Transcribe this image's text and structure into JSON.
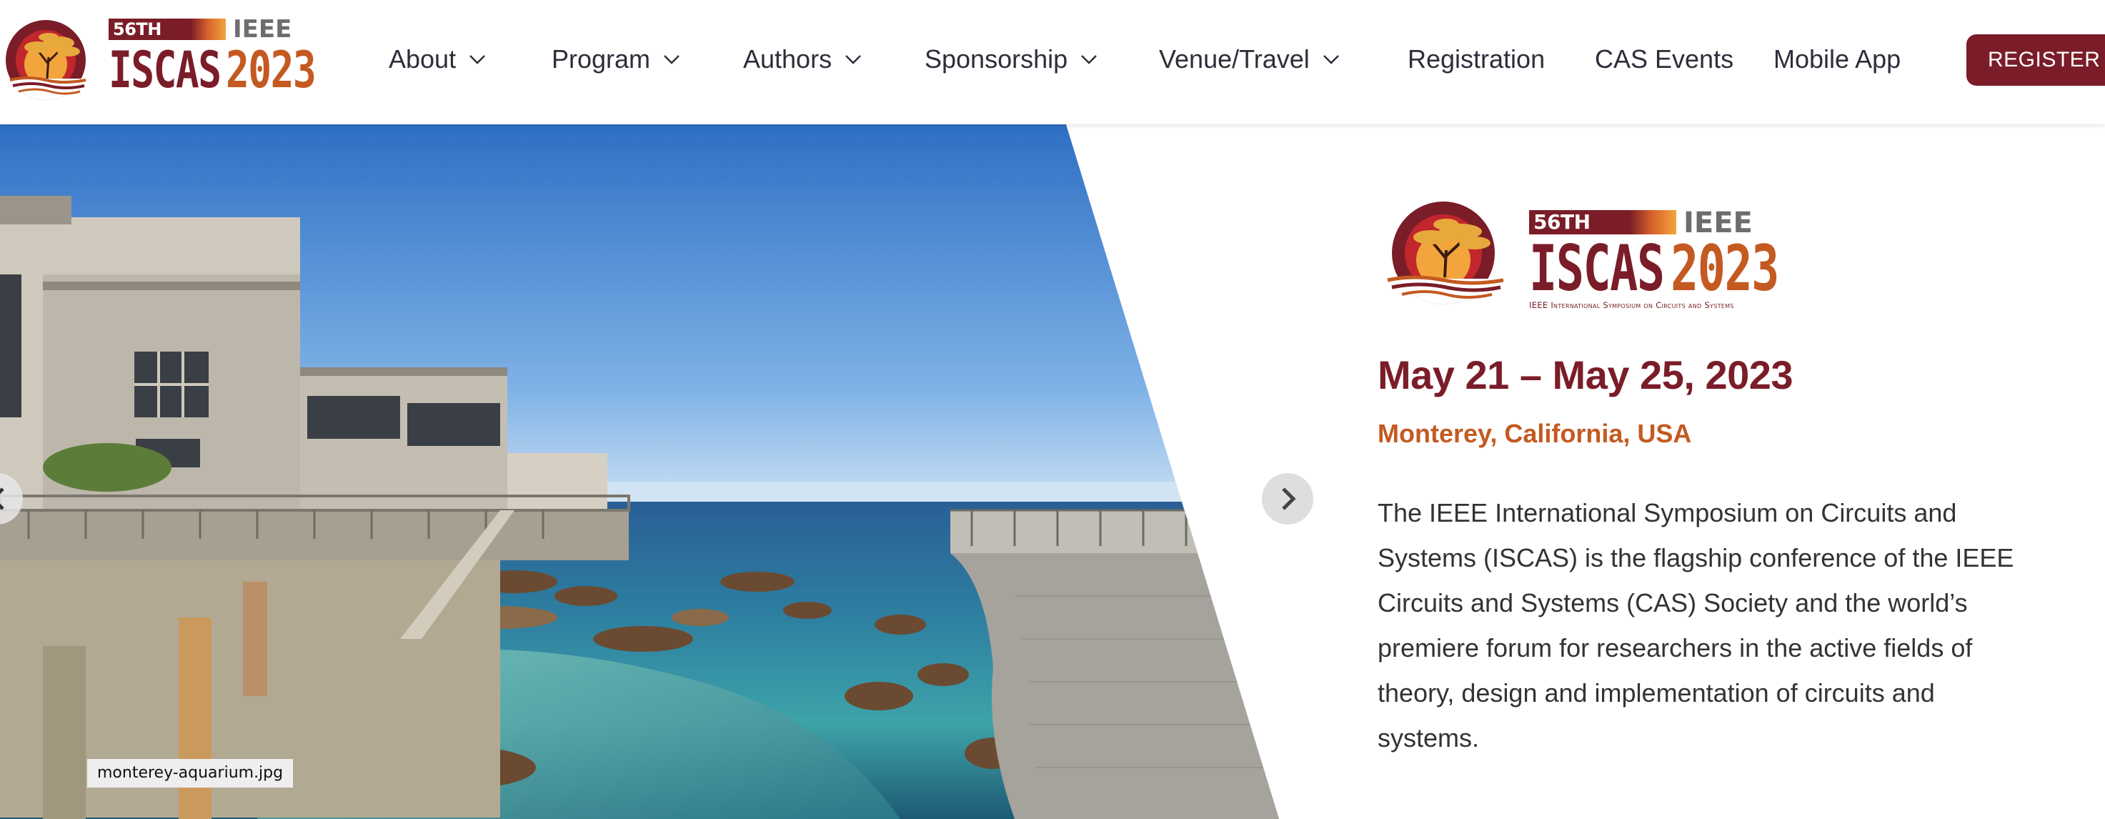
{
  "logo": {
    "edition": "56TH EDITION",
    "ieee": "IEEE",
    "iscas": "ISCAS",
    "year": "2023",
    "subtitle": "IEEE International Symposium on Circuits and Systems",
    "colors": {
      "maroon": "#7a1d28",
      "orange": "#c45a21",
      "gold": "#f2a53c"
    }
  },
  "nav": {
    "items": [
      {
        "label": "About",
        "dropdown": true
      },
      {
        "label": "Program",
        "dropdown": true
      },
      {
        "label": "Authors",
        "dropdown": true
      },
      {
        "label": "Sponsorship",
        "dropdown": true
      },
      {
        "label": "Venue/Travel",
        "dropdown": true
      },
      {
        "label": "Registration",
        "dropdown": false
      },
      {
        "label": "CAS Events",
        "dropdown": false
      },
      {
        "label": "Mobile App",
        "dropdown": false
      }
    ],
    "register_label": "REGISTER N",
    "chevron_icon": "chevron-down-icon"
  },
  "hero": {
    "image_filename": "monterey-aquarium.jpg",
    "prev_icon": "chevron-left-icon",
    "next_icon": "chevron-right-icon"
  },
  "event": {
    "dates": "May 21 – May 25, 2023",
    "location": "Monterey, California, USA",
    "description": "The IEEE International Symposium on Circuits and Systems (ISCAS) is the flagship conference of the IEEE Circuits and Systems (CAS) Society and the world’s premiere forum for researchers in the active fields of theory, design and implementation of circuits and systems.",
    "colors": {
      "dates": "#7a1d28",
      "location": "#c45a21"
    }
  }
}
